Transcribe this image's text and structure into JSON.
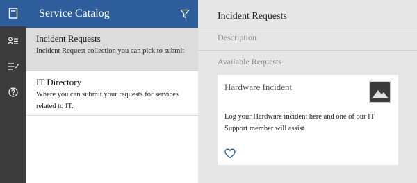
{
  "rail": {
    "items": [
      {
        "icon": "catalog-book-icon",
        "active": true
      },
      {
        "icon": "user-list-icon",
        "active": false
      },
      {
        "icon": "checklist-icon",
        "active": false
      },
      {
        "icon": "help-circle-icon",
        "active": false
      }
    ]
  },
  "catalog": {
    "title": "Service Catalog",
    "filter_icon": "filter-icon",
    "items": [
      {
        "title": "Incident Requests",
        "description": "Incident Request collection you can pick to submit"
      },
      {
        "title": "IT Directory",
        "description": "Where you can submit your requests for services related to IT."
      }
    ]
  },
  "main": {
    "title": "Incident Requests",
    "description_label": "Description",
    "available_label": "Available Requests",
    "cards": [
      {
        "title": "Hardware Incident",
        "image_icon": "image-placeholder-icon",
        "body": "Log your Hardware incident here and one of our IT Support member will assist.",
        "favorite_icon": "heart-icon"
      }
    ]
  },
  "colors": {
    "rail_bg": "#3b3b3b",
    "accent": "#2d5e9b",
    "selected_bg": "#dcdcdc",
    "main_bg": "#e6e6e6"
  }
}
